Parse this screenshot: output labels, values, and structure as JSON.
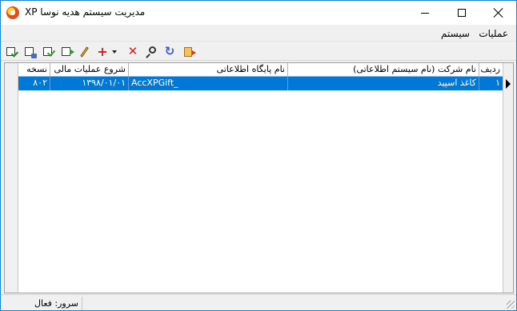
{
  "window": {
    "title": "مدیریت سیستم هدیه نوسا XP",
    "icon": "app-logo-icon",
    "accent_color": "#1883d7"
  },
  "menu": {
    "items": [
      "عملیات",
      "سیستم"
    ]
  },
  "toolbar": {
    "icons": [
      "select-doc-icon",
      "edit-doc-icon",
      "confirm-doc-icon",
      "open-doc-icon",
      "pencil-icon",
      "add-icon",
      "dropdown-arrow-icon",
      "delete-icon",
      "search-icon",
      "refresh-icon",
      "exit-icon"
    ]
  },
  "grid": {
    "columns": [
      "ردیف",
      "نام شرکت (نام سیستم اطلاعاتی)",
      "نام پایگاه اطلاعاتی",
      "شروع عملیات مالی",
      "نسخه"
    ],
    "rows": [
      {
        "index": "۱",
        "company": "کاغذ اسپید",
        "database": "AccXPGift_",
        "start": "۱۳۹۸/۰۱/۰۱",
        "version": "۸۰۲"
      }
    ],
    "selection_color": "#0078d7"
  },
  "status": {
    "server": "سرور: فعال"
  }
}
